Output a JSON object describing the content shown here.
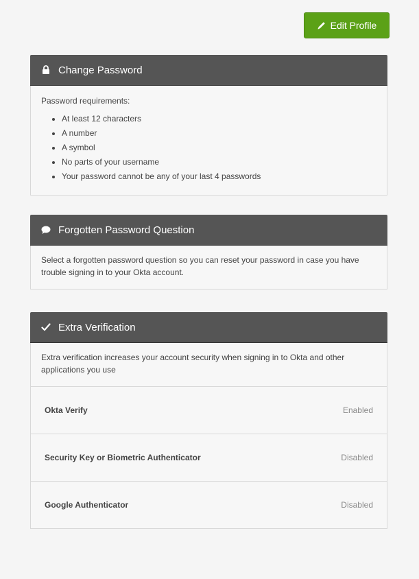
{
  "edit_profile": {
    "label": "Edit Profile",
    "icon": "pencil-icon"
  },
  "change_password": {
    "title": "Change Password",
    "icon": "lock-icon",
    "intro": "Password requirements:",
    "requirements": [
      "At least 12 characters",
      "A number",
      "A symbol",
      "No parts of your username",
      "Your password cannot be any of your last 4 passwords"
    ]
  },
  "forgotten_question": {
    "title": "Forgotten Password Question",
    "icon": "speech-bubble-icon",
    "description": "Select a forgotten password question so you can reset your password in case you have trouble signing in to your Okta account."
  },
  "extra_verification": {
    "title": "Extra Verification",
    "icon": "checkmark-icon",
    "description": "Extra verification increases your account security when signing in to Okta and other applications you use",
    "factors": [
      {
        "name": "Okta Verify",
        "status": "Enabled"
      },
      {
        "name": "Security Key or Biometric Authenticator",
        "status": "Disabled"
      },
      {
        "name": "Google Authenticator",
        "status": "Disabled"
      }
    ]
  },
  "colors": {
    "page_bg": "#f5f5f5",
    "header_bg": "#555555",
    "button_green": "#5ba117"
  }
}
